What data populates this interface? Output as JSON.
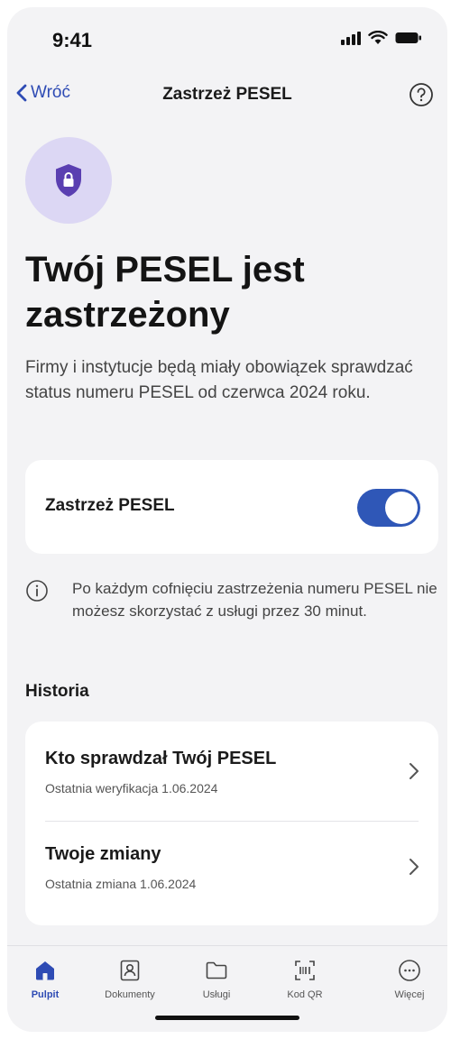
{
  "status_bar": {
    "time": "9:41"
  },
  "nav": {
    "back_label": "Wróć",
    "title": "Zastrzeż PESEL"
  },
  "hero": {
    "headline": "Twój PESEL jest zastrzeżony",
    "subtext": "Firmy i instytucje będą miały obowiązek sprawdzać status numeru PESEL od czerwca 2024 roku."
  },
  "toggle_card": {
    "label": "Zastrzeż PESEL",
    "enabled": true
  },
  "info": {
    "text": "Po każdym cofnięciu zastrzeżenia numeru PESEL nie możesz skorzystać z usługi przez 30 minut."
  },
  "history": {
    "section_title": "Historia",
    "items": [
      {
        "title": "Kto sprawdzał Twój PESEL",
        "subtitle": "Ostatnia weryfikacja 1.06.2024"
      },
      {
        "title": "Twoje zmiany",
        "subtitle": "Ostatnia zmiana 1.06.2024"
      }
    ]
  },
  "tabs": [
    {
      "label": "Pulpit",
      "icon": "home-icon",
      "active": true
    },
    {
      "label": "Dokumenty",
      "icon": "id-card-icon",
      "active": false
    },
    {
      "label": "Usługi",
      "icon": "folder-icon",
      "active": false
    },
    {
      "label": "Kod QR",
      "icon": "qr-code-icon",
      "active": false
    },
    {
      "label": "Więcej",
      "icon": "more-icon",
      "active": false
    }
  ],
  "colors": {
    "accent": "#2e4bb4",
    "toggle_on": "#2f57b7",
    "shield_bg": "#dcd7f4",
    "shield": "#5a3fb1",
    "background": "#f3f3f5"
  }
}
